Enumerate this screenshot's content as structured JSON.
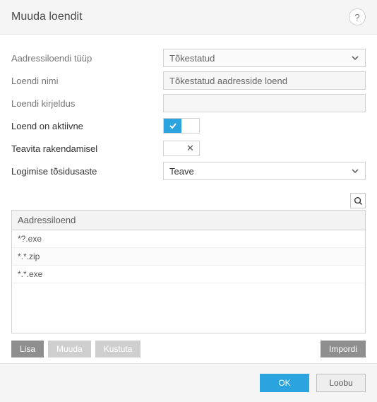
{
  "header": {
    "title": "Muuda loendit"
  },
  "form": {
    "type_label": "Aadressiloendi tüüp",
    "type_value": "Tõkestatud",
    "name_label": "Loendi nimi",
    "name_value": "Tõkestatud aadresside loend",
    "desc_label": "Loendi kirjeldus",
    "desc_value": "",
    "active_label": "Loend on aktiivne",
    "notify_label": "Teavita rakendamisel",
    "severity_label": "Logimise tõsidusaste",
    "severity_value": "Teave"
  },
  "table": {
    "header": "Aadressiloend",
    "rows": [
      "*?.exe",
      "*.*.zip",
      "*.*.exe"
    ]
  },
  "actions": {
    "add": "Lisa",
    "edit": "Muuda",
    "delete": "Kustuta",
    "import": "Impordi"
  },
  "footer": {
    "ok": "OK",
    "cancel": "Loobu"
  }
}
